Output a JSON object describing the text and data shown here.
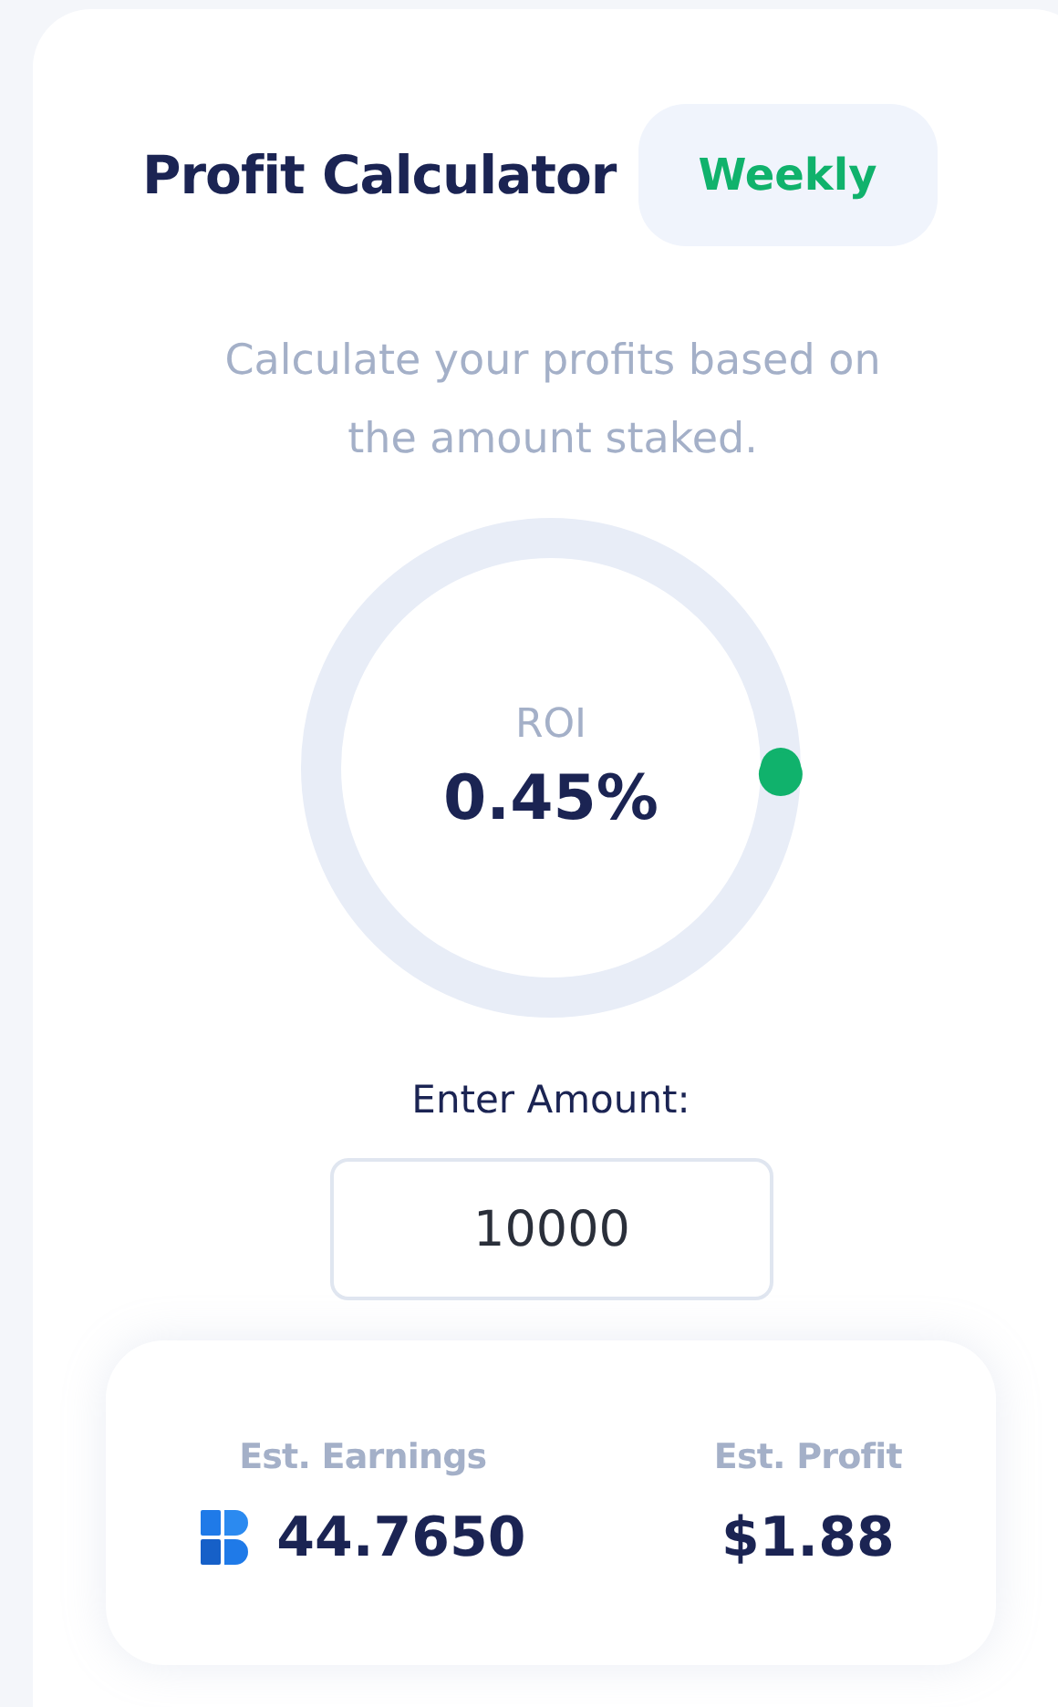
{
  "header": {
    "title": "Profit Calculator",
    "period": "Weekly"
  },
  "description": "Calculate your profits based on the amount staked.",
  "roi": {
    "label": "ROI",
    "value": "0.45%",
    "level": 0.0045
  },
  "amount": {
    "label": "Enter Amount:",
    "value": "10000"
  },
  "results": [
    {
      "label": "Est. Earnings",
      "value": "44.7650",
      "token_icon": true
    },
    {
      "label": "Est. Profit",
      "value": "$1.88",
      "token_icon": false
    }
  ]
}
